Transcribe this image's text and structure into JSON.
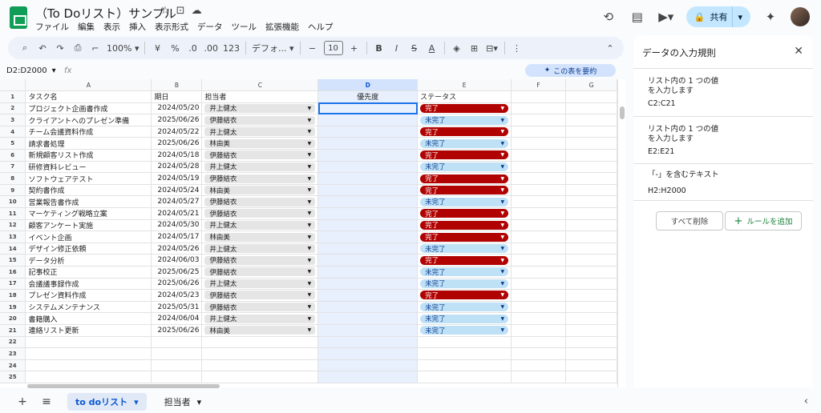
{
  "app": {
    "doc_title": "（To Doリスト）サンプル",
    "menu": [
      "ファイル",
      "編集",
      "表示",
      "挿入",
      "表示形式",
      "データ",
      "ツール",
      "拡張機能",
      "ヘルプ"
    ],
    "share_label": "共有"
  },
  "toolbar": {
    "zoom": "100%",
    "currency": "¥",
    "percent": "%",
    "dec_less": ".0",
    "dec_more": ".00",
    "number_format": "123",
    "font_name": "デフォ...",
    "font_size": "10"
  },
  "formula_bar": {
    "name_box": "D2:D2000",
    "fx": "fx",
    "summarize_label": "この表を要約"
  },
  "grid": {
    "col_headers": [
      "A",
      "B",
      "C",
      "D",
      "E",
      "F",
      "G"
    ],
    "header_row": {
      "task": "タスク名",
      "due": "期日",
      "assignee": "担当者",
      "priority": "優先度",
      "status": "ステータス"
    },
    "rows": [
      {
        "task": "プロジェクト企画書作成",
        "due": "2024/05/20",
        "assignee": "井上健太",
        "status": "完了"
      },
      {
        "task": "クライアントへのプレゼン準備",
        "due": "2025/06/26",
        "assignee": "伊藤結衣",
        "status": "未完了"
      },
      {
        "task": "チーム会議資料作成",
        "due": "2024/05/22",
        "assignee": "井上健太",
        "status": "完了"
      },
      {
        "task": "請求書処理",
        "due": "2025/06/26",
        "assignee": "林由美",
        "status": "未完了"
      },
      {
        "task": "新規顧客リスト作成",
        "due": "2024/05/18",
        "assignee": "伊藤結衣",
        "status": "完了"
      },
      {
        "task": "研修資料レビュー",
        "due": "2024/05/28",
        "assignee": "井上健太",
        "status": "未完了"
      },
      {
        "task": "ソフトウェアテスト",
        "due": "2024/05/19",
        "assignee": "伊藤結衣",
        "status": "完了"
      },
      {
        "task": "契約書作成",
        "due": "2024/05/24",
        "assignee": "林由美",
        "status": "完了"
      },
      {
        "task": "営業報告書作成",
        "due": "2024/05/27",
        "assignee": "伊藤結衣",
        "status": "未完了"
      },
      {
        "task": "マーケティング戦略立案",
        "due": "2024/05/21",
        "assignee": "伊藤結衣",
        "status": "完了"
      },
      {
        "task": "顧客アンケート実施",
        "due": "2024/05/30",
        "assignee": "井上健太",
        "status": "完了"
      },
      {
        "task": "イベント企画",
        "due": "2024/05/17",
        "assignee": "林由美",
        "status": "完了"
      },
      {
        "task": "デザイン修正依頼",
        "due": "2024/05/26",
        "assignee": "井上健太",
        "status": "未完了"
      },
      {
        "task": "データ分析",
        "due": "2024/06/03",
        "assignee": "伊藤結衣",
        "status": "完了"
      },
      {
        "task": "記事校正",
        "due": "2025/06/25",
        "assignee": "伊藤結衣",
        "status": "未完了"
      },
      {
        "task": "会議議事録作成",
        "due": "2025/06/26",
        "assignee": "井上健太",
        "status": "未完了"
      },
      {
        "task": "プレゼン資料作成",
        "due": "2024/05/23",
        "assignee": "伊藤結衣",
        "status": "完了"
      },
      {
        "task": "システムメンテナンス",
        "due": "2025/05/31",
        "assignee": "伊藤結衣",
        "status": "未完了"
      },
      {
        "task": "書籍購入",
        "due": "2024/06/04",
        "assignee": "井上健太",
        "status": "未完了"
      },
      {
        "task": "連絡リスト更新",
        "due": "2025/06/26",
        "assignee": "林由美",
        "status": "未完了"
      }
    ],
    "row_numbers": [
      "1",
      "2",
      "3",
      "4",
      "5",
      "6",
      "7",
      "8",
      "9",
      "10",
      "11",
      "12",
      "13",
      "14",
      "15",
      "16",
      "17",
      "18",
      "19",
      "20",
      "21",
      "22",
      "23",
      "24",
      "25"
    ],
    "status_colors": {
      "完了": "#b10202",
      "未完了": "#bfe1f6"
    }
  },
  "sheets": {
    "tabs": [
      "to doリスト",
      "担当者"
    ],
    "active": "to doリスト"
  },
  "panel": {
    "title": "データの入力規則",
    "rules": [
      {
        "desc": "リスト内の 1 つの値\nを入力します",
        "range": "C2:C21"
      },
      {
        "desc": "リスト内の 1 つの値\nを入力します",
        "range": "E2:E21"
      },
      {
        "desc": "「-」を含むテキスト",
        "range": "H2:H2000"
      }
    ],
    "delete_all_label": "すべて削除",
    "add_rule_label": "ルールを追加"
  }
}
